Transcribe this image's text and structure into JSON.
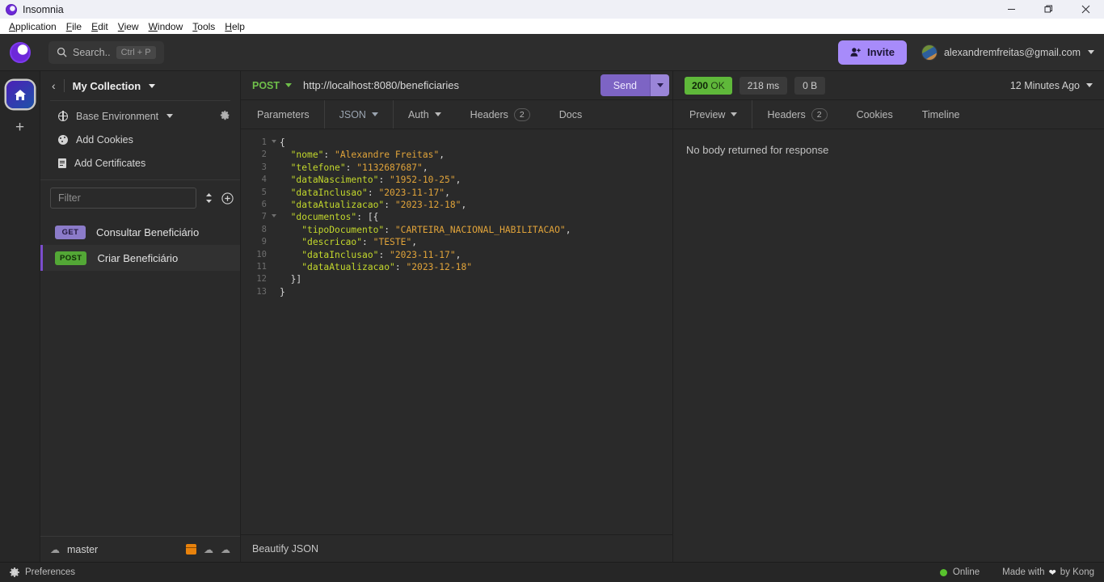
{
  "window": {
    "app_title": "Insomnia",
    "controls": {
      "minimize": "minimize-icon",
      "maximize": "restore-icon",
      "close": "close-icon"
    }
  },
  "menubar": {
    "items": [
      "Application",
      "File",
      "Edit",
      "View",
      "Window",
      "Tools",
      "Help"
    ]
  },
  "header": {
    "search": {
      "placeholder": "Search..",
      "shortcut": "Ctrl + P"
    },
    "invite_label": "Invite",
    "user_email": "alexandremfreitas@gmail.com"
  },
  "rail": {
    "home_label": "home-icon",
    "add_label": "+"
  },
  "sidebar": {
    "collection_name": "My Collection",
    "rows": [
      {
        "label": "Base Environment",
        "icon": "globe-icon",
        "has_caret": true,
        "has_gear": true
      },
      {
        "label": "Add Cookies",
        "icon": "cookie-icon",
        "has_caret": false,
        "has_gear": false
      },
      {
        "label": "Add Certificates",
        "icon": "certificate-icon",
        "has_caret": false,
        "has_gear": false
      }
    ],
    "filter_placeholder": "Filter",
    "filter_value": "",
    "requests": [
      {
        "method": "GET",
        "name": "Consultar Beneficiário",
        "active": false
      },
      {
        "method": "POST",
        "name": "Criar Beneficiário",
        "active": true
      }
    ],
    "footer": {
      "branch": "master",
      "icons": [
        "box-icon",
        "cloud-download-icon",
        "cloud-upload-icon"
      ]
    }
  },
  "request": {
    "method": "POST",
    "url": "http://localhost:8080/beneficiaries",
    "send_label": "Send",
    "tabs": [
      {
        "label": "Parameters",
        "badge": null,
        "caret": false,
        "selected": false
      },
      {
        "label": "JSON",
        "badge": null,
        "caret": true,
        "selected": true
      },
      {
        "label": "Auth",
        "badge": null,
        "caret": true,
        "selected": false
      },
      {
        "label": "Headers",
        "badge": "2",
        "caret": false,
        "selected": false
      },
      {
        "label": "Docs",
        "badge": null,
        "caret": false,
        "selected": false
      }
    ],
    "beautify_label": "Beautify JSON",
    "body_lines": [
      {
        "n": 1,
        "fold": true,
        "html": "<span class=\"p\">{</span>"
      },
      {
        "n": 2,
        "fold": false,
        "html": "  <span class=\"k\">\"nome\"</span><span class=\"p\">: </span><span class=\"v\">\"Alexandre Freitas\"</span><span class=\"p\">,</span>"
      },
      {
        "n": 3,
        "fold": false,
        "html": "  <span class=\"k\">\"telefone\"</span><span class=\"p\">: </span><span class=\"v\">\"1132687687\"</span><span class=\"p\">,</span>"
      },
      {
        "n": 4,
        "fold": false,
        "html": "  <span class=\"k\">\"dataNascimento\"</span><span class=\"p\">: </span><span class=\"v\">\"1952-10-25\"</span><span class=\"p\">,</span>"
      },
      {
        "n": 5,
        "fold": false,
        "html": "  <span class=\"k\">\"dataInclusao\"</span><span class=\"p\">: </span><span class=\"v\">\"2023-11-17\"</span><span class=\"p\">,</span>"
      },
      {
        "n": 6,
        "fold": false,
        "html": "  <span class=\"k\">\"dataAtualizacao\"</span><span class=\"p\">: </span><span class=\"v\">\"2023-12-18\"</span><span class=\"p\">,</span>"
      },
      {
        "n": 7,
        "fold": true,
        "html": "  <span class=\"k\">\"documentos\"</span><span class=\"p\">: [{</span>"
      },
      {
        "n": 8,
        "fold": false,
        "html": "    <span class=\"k\">\"tipoDocumento\"</span><span class=\"p\">: </span><span class=\"v\">\"CARTEIRA_NACIONAL_HABILITACAO\"</span><span class=\"p\">,</span>"
      },
      {
        "n": 9,
        "fold": false,
        "html": "    <span class=\"k\">\"descricao\"</span><span class=\"p\">: </span><span class=\"v\">\"TESTE\"</span><span class=\"p\">,</span>"
      },
      {
        "n": 10,
        "fold": false,
        "html": "    <span class=\"k\">\"dataInclusao\"</span><span class=\"p\">: </span><span class=\"v\">\"2023-11-17\"</span><span class=\"p\">,</span>"
      },
      {
        "n": 11,
        "fold": false,
        "html": "    <span class=\"k\">\"dataAtualizacao\"</span><span class=\"p\">: </span><span class=\"v\">\"2023-12-18\"</span>"
      },
      {
        "n": 12,
        "fold": false,
        "html": "  <span class=\"p\">}]</span>"
      },
      {
        "n": 13,
        "fold": false,
        "html": "<span class=\"p\">}</span>"
      }
    ]
  },
  "response": {
    "status_code": "200",
    "status_text": "OK",
    "time": "218 ms",
    "size": "0 B",
    "time_ago": "12 Minutes Ago",
    "tabs": [
      {
        "label": "Preview",
        "badge": null,
        "caret": true,
        "selected": true
      },
      {
        "label": "Headers",
        "badge": "2",
        "caret": false,
        "selected": false
      },
      {
        "label": "Cookies",
        "badge": null,
        "caret": false,
        "selected": false
      },
      {
        "label": "Timeline",
        "badge": null,
        "caret": false,
        "selected": false
      }
    ],
    "body_message": "No body returned for response"
  },
  "statusbar": {
    "preferences_label": "Preferences",
    "online_label": "Online",
    "made_with_prefix": "Made with",
    "made_with_suffix": "by Kong"
  },
  "colors": {
    "accent_purple": "#7c4dcd",
    "status_green": "#5fb83a",
    "method_get": "#8b7bc9",
    "method_post": "#53a736",
    "json_key": "#c3d82c",
    "json_value": "#e0a33a",
    "online_dot": "#58c22d",
    "box_orange": "#e8820c"
  }
}
